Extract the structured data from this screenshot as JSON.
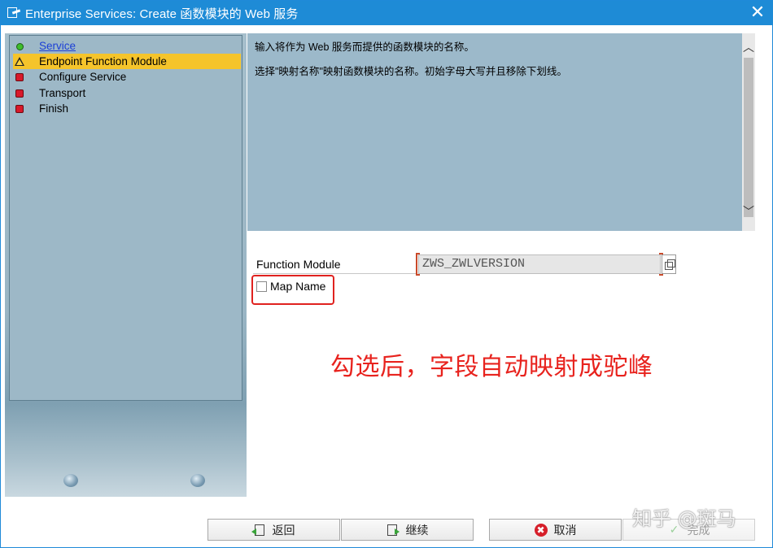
{
  "window": {
    "title": "Enterprise Services: Create 函数模块的 Web 服务",
    "close_glyph": "✕"
  },
  "steps": [
    {
      "label": "Service",
      "status": "done",
      "icon": "green-circle-icon",
      "link": true
    },
    {
      "label": "Endpoint Function Module",
      "status": "current",
      "icon": "warning-triangle-icon"
    },
    {
      "label": "Configure Service",
      "status": "pending",
      "icon": "red-square-icon"
    },
    {
      "label": "Transport",
      "status": "pending",
      "icon": "red-square-icon"
    },
    {
      "label": "Finish",
      "status": "pending",
      "icon": "red-square-icon"
    }
  ],
  "help": {
    "line1": "输入将作为 Web 服务而提供的函数模块的名称。",
    "line2": "选择\"映射名称\"映射函数模块的名称。初始字母大写并且移除下划线。"
  },
  "form": {
    "function_module_label": "Function Module",
    "function_module_value": "ZWS_ZWLVERSION",
    "map_name_label": "Map Name",
    "map_name_checked": false
  },
  "annotation": "勾选后，字段自动映射成驼峰",
  "buttons": {
    "back": "返回",
    "continue": "继续",
    "cancel": "取消",
    "finish": "完成",
    "cancel_glyph": "✖",
    "finish_glyph": "✓"
  },
  "watermark": "知乎 @斑马",
  "colors": {
    "titlebar": "#1e8bd6",
    "active_step": "#f5c42b",
    "annotation": "#e8231e",
    "panel": "#9cb9ca"
  }
}
